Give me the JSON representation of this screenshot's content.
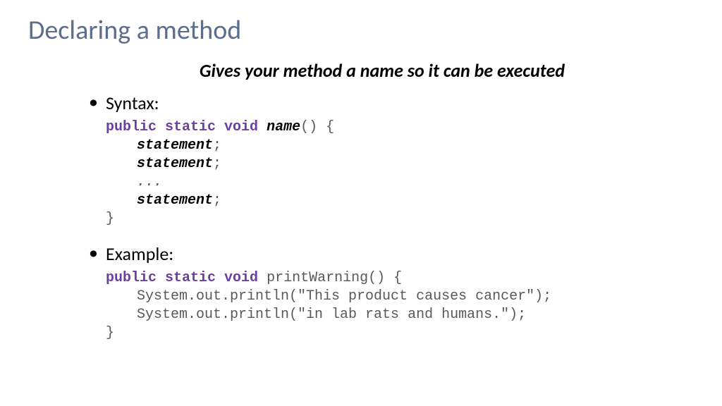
{
  "title": "Declaring a method",
  "subtitle": "Gives your method a name so it can be executed",
  "bullets": {
    "syntax": "Syntax:",
    "example": "Example:"
  },
  "syntax_code": {
    "keywords": "public static void",
    "name": "name",
    "open": "() {",
    "stmt": "statement",
    "semi": ";",
    "ellipsis": "...",
    "close": "}"
  },
  "example_code": {
    "keywords": "public static void",
    "method_name": "printWarning() {",
    "line1": "System.out.println(\"This product causes cancer\");",
    "line2": "System.out.println(\"in lab rats and humans.\");",
    "close": "}"
  }
}
